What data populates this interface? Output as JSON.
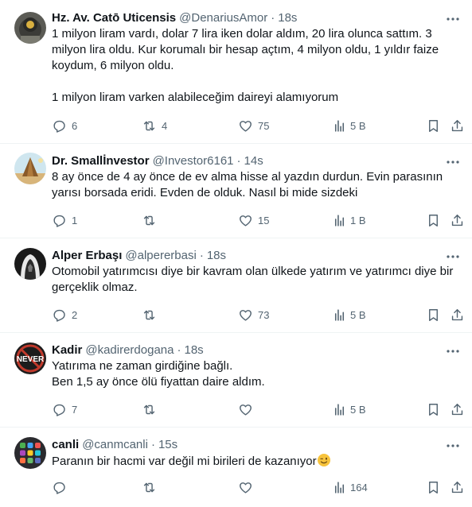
{
  "tweets": [
    {
      "name": "Hz. Av. Catō Uticensis",
      "handle": "@DenariusAmor",
      "sep": "·",
      "time": "18s",
      "text": "1 milyon liram vardı, dolar 7 lira iken dolar aldım, 20 lira olunca sattım. 3\nmilyon lira oldu. Kur korumalı bir hesap açtım, 4 milyon oldu, 1 yıldır faize\nkoydum, 6 milyon oldu.\n\n1 milyon liram varken alabileceğim daireyi alamıyorum",
      "replies": "6",
      "retweets": "4",
      "likes": "75",
      "views": "5 B"
    },
    {
      "name": "Dr. Smallİnvestor",
      "handle": "@Investor6161",
      "sep": "·",
      "time": "14s",
      "text": "8 ay önce de 4 ay önce de ev alma hisse al yazdın durdun. Evin parasının\nyarısı borsada eridi. Evden de olduk. Nasıl bi mide sizdeki",
      "replies": "1",
      "retweets": "",
      "likes": "15",
      "views": "1 B"
    },
    {
      "name": "Alper Erbaşı",
      "handle": "@alpererbasi",
      "sep": "·",
      "time": "18s",
      "text": "Otomobil yatırımcısı diye bir kavram olan ülkede yatırım ve yatırımcı diye bir\ngerçeklik olmaz.",
      "replies": "2",
      "retweets": "",
      "likes": "73",
      "views": "5 B"
    },
    {
      "name": "Kadir",
      "handle": "@kadirerdogana",
      "sep": "·",
      "time": "18s",
      "text": "Yatırıma ne zaman girdiğine bağlı.\nBen 1,5 ay önce ölü fiyattan daire aldım.",
      "replies": "7",
      "retweets": "",
      "likes": "",
      "views": "5 B"
    },
    {
      "name": "canli",
      "handle": "@canmcanli",
      "sep": "·",
      "time": "15s",
      "text": "Paranın bir hacmi var değil mi birileri de kazanıyor",
      "replies": "",
      "retweets": "",
      "likes": "",
      "views": "164"
    }
  ],
  "avatars": {
    "kadir_text": "NEVER"
  },
  "icons": {
    "more": "more-icon",
    "reply": "reply-icon",
    "retweet": "retweet-icon",
    "like": "like-icon",
    "views": "views-icon",
    "bookmark": "bookmark-icon",
    "share": "share-icon",
    "emoji": "winking-face-emoji"
  },
  "colors": {
    "text": "#0f1419",
    "secondary": "#536471",
    "divider": "#eff3f4"
  }
}
